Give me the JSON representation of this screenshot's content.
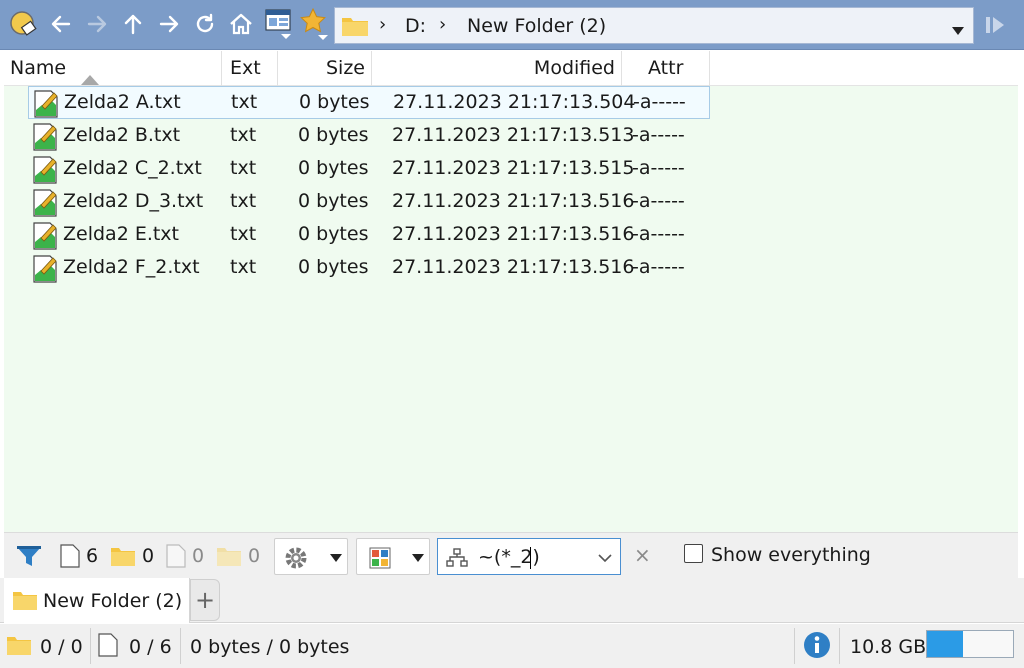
{
  "toolbar": {
    "buttons": [
      "app-icon",
      "back-icon",
      "forward-icon",
      "up-icon",
      "next-icon",
      "refresh-icon",
      "home-icon",
      "layout-icon",
      "favorites-star-icon"
    ],
    "address": {
      "drive": "D:",
      "folder": "New Folder (2)",
      "separator": "›"
    }
  },
  "columns": {
    "name": "Name",
    "ext": "Ext",
    "size": "Size",
    "modified": "Modified",
    "attr": "Attr"
  },
  "files": [
    {
      "name": "Zelda2 A.txt",
      "ext": "txt",
      "size": "0 bytes",
      "modified": "27.11.2023  21:17:13.504",
      "attr": "-a-----"
    },
    {
      "name": "Zelda2 B.txt",
      "ext": "txt",
      "size": "0 bytes",
      "modified": "27.11.2023  21:17:13.513",
      "attr": "-a-----"
    },
    {
      "name": "Zelda2 C_2.txt",
      "ext": "txt",
      "size": "0 bytes",
      "modified": "27.11.2023  21:17:13.515",
      "attr": "-a-----"
    },
    {
      "name": "Zelda2 D_3.txt",
      "ext": "txt",
      "size": "0 bytes",
      "modified": "27.11.2023  21:17:13.516",
      "attr": "-a-----"
    },
    {
      "name": "Zelda2 E.txt",
      "ext": "txt",
      "size": "0 bytes",
      "modified": "27.11.2023  21:17:13.516",
      "attr": "-a-----"
    },
    {
      "name": "Zelda2 F_2.txt",
      "ext": "txt",
      "size": "0 bytes",
      "modified": "27.11.2023  21:17:13.516",
      "attr": "-a-----"
    }
  ],
  "filterbar": {
    "files_count": "6",
    "folders_count": "0",
    "hidden_files_count": "0",
    "hidden_folders_count": "0",
    "filter_text": "~(*_2)",
    "clear_label": "×",
    "show_everything_label": "Show everything"
  },
  "tabs": [
    {
      "label": "New Folder (2)"
    }
  ],
  "tab_add_label": "+",
  "status": {
    "folders": "0 / 0",
    "files": "0 / 6",
    "bytes": "0 bytes / 0 bytes",
    "free_space": "10.8 GB",
    "free_fraction": 0.42
  },
  "colors": {
    "toolbar": "#7c9cc8",
    "list_bg": "#f0fbf0",
    "accent": "#2b9be6",
    "folder": "#f4c542"
  }
}
